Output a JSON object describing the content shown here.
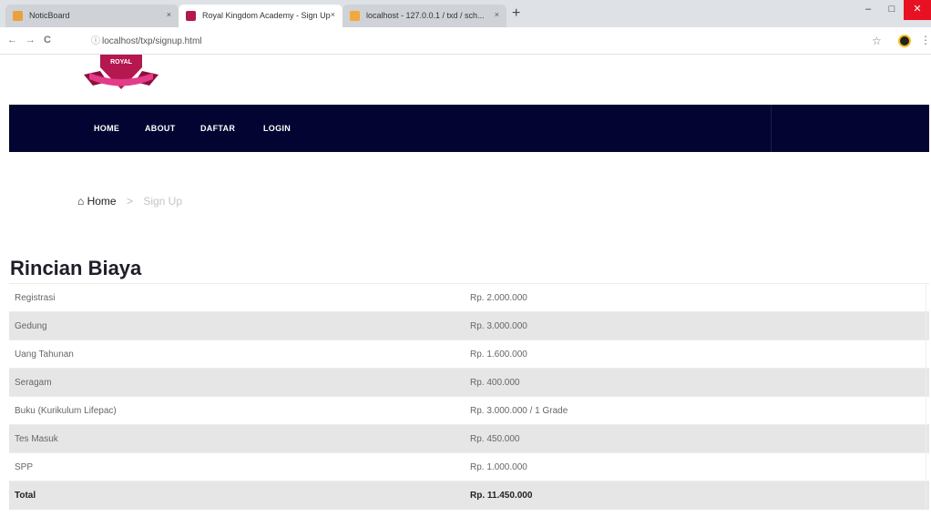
{
  "browser": {
    "tabs": [
      {
        "title": "NoticBoard",
        "active": false
      },
      {
        "title": "Royal Kingdom Academy - Sign Up",
        "active": true
      },
      {
        "title": "localhost - 127.0.0.1 / txd / sch...",
        "active": false
      }
    ],
    "close_label": "×",
    "new_tab_label": "+",
    "window": {
      "minimize": "–",
      "maximize": "□",
      "close": "✕"
    },
    "nav": {
      "back": "←",
      "forward": "→",
      "reload": "C"
    },
    "url": "localhost/txp/signup.html",
    "star": "☆",
    "menu": "⋮"
  },
  "logo": {
    "text": "ROYAL",
    "colors": {
      "primary": "#b4184f",
      "accent": "#e33c8a"
    }
  },
  "nav": {
    "items": [
      "HOME",
      "ABOUT",
      "DAFTAR",
      "LOGIN"
    ],
    "background": "#040432"
  },
  "breadcrumb": {
    "home_icon": "home-icon",
    "home": "Home",
    "separator": ">",
    "current": "Sign Up"
  },
  "section": {
    "title": "Rincian Biaya"
  },
  "fees": {
    "rows": [
      {
        "item": "Registrasi",
        "amount": "Rp. 2.000.000"
      },
      {
        "item": "Gedung",
        "amount": "Rp. 3.000.000"
      },
      {
        "item": "Uang Tahunan",
        "amount": "Rp. 1.600.000"
      },
      {
        "item": "Seragam",
        "amount": "Rp. 400.000"
      },
      {
        "item": "Buku (Kurikulum Lifepac)",
        "amount": "Rp. 3.000.000 / 1 Grade"
      },
      {
        "item": "Tes Masuk",
        "amount": "Rp. 450.000"
      },
      {
        "item": "SPP",
        "amount": "Rp. 1.000.000"
      }
    ],
    "total": {
      "item": "Total",
      "amount": "Rp. 11.450.000"
    }
  }
}
